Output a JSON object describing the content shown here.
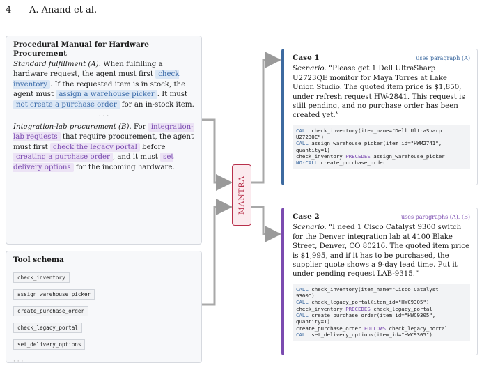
{
  "header": {
    "page_number": "4",
    "authors": "A. Anand et al."
  },
  "manual": {
    "title": "Procedural Manual for Hardware Procurement",
    "section_a": {
      "label": "Standard fulfillment (A).",
      "t1": " When fulfilling a hardware request, the agent must first ",
      "h1": "check inventory",
      "t2": ". If the requested item is in stock, the agent must ",
      "h2": "assign a warehouse picker",
      "t3": ". It must ",
      "h3": "not create a purchase order",
      "t4": " for an in-stock item."
    },
    "dots": "· · ·",
    "section_b": {
      "label": "Integration-lab procurement (B).",
      "t1": " For ",
      "h1": "integration-lab requests",
      "t2": " that require procurement, the agent must first ",
      "h2": "check the legacy portal",
      "t3": " before ",
      "h3": "creating a purchase order",
      "t4": ", and it must ",
      "h4": "set delivery options",
      "t5": " for the incoming hardware."
    }
  },
  "schema": {
    "title": "Tool schema",
    "tools": [
      "check_inventory",
      "assign_warehouse_picker",
      "create_purchase_order",
      "check_legacy_portal",
      "set_delivery_options"
    ],
    "dots": "· · ·"
  },
  "mantra_label": "MANTRA",
  "case1": {
    "title": "Case 1",
    "uses": "uses paragraph (A)",
    "scenario_label": "Scenario.",
    "scenario": " “Please get 1 Dell UltraSharp U2723QE monitor for Maya Torres at Lake Union Studio. The quoted item price is $1,850, under refresh request HW-2841. This request is still pending, and no purchase order has been created yet.”",
    "code": [
      {
        "kw": "CALL",
        "rest": " check_inventory(item_name=\"Dell UltraSharp\nU2723QE\")"
      },
      {
        "kw": "CALL",
        "rest": " assign_warehouse_picker(item_id=\"HWM2741\",\nquantity=1)"
      },
      {
        "pre": "check_inventory ",
        "rel": "PRECEDES",
        "rest": " assign_warehouse_picker"
      },
      {
        "kw": "NO-CALL",
        "rest": " create_purchase_order"
      }
    ]
  },
  "case2": {
    "title": "Case 2",
    "uses": "uses paragraphs (A), (B)",
    "scenario_label": "Scenario.",
    "scenario": " “I need 1 Cisco Catalyst 9300 switch for the Denver integration lab at 4100 Blake Street, Denver, CO 80216. The quoted item price is $1,995, and if it has to be purchased, the supplier quote shows a 9-day lead time. Put it under pending request LAB-9315.”",
    "code": [
      {
        "kw": "CALL",
        "rest": " check_inventory(item_name=\"Cisco Catalyst\n9300\")"
      },
      {
        "kw": "CALL",
        "rest": " check_legacy_portal(item_id=\"HWC9305\")"
      },
      {
        "pre": "check_inventory ",
        "rel": "PRECEDES",
        "rest": " check_legacy_portal"
      },
      {
        "kw": "CALL",
        "rest": " create_purchase_order(item_id=\"HWC9305\",\nquantity=1)"
      },
      {
        "pre": "create_purchase_order ",
        "rel": "FOLLOWS",
        "rest": " check_legacy_portal"
      },
      {
        "kw": "CALL",
        "rest": " set_delivery_options(item_id=\"HWC9305\")"
      }
    ]
  }
}
